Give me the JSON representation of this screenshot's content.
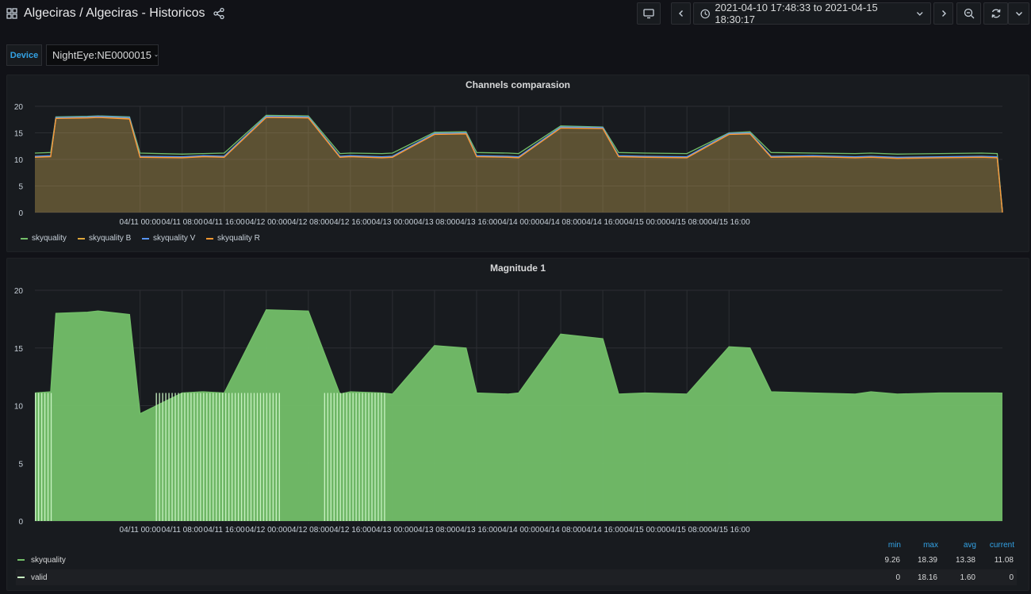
{
  "header": {
    "title": "Algeciras / Algeciras - Historicos",
    "time_range": "2021-04-10 17:48:33 to 2021-04-15 18:30:17",
    "icons": [
      "grid-icon",
      "share-icon",
      "tv-icon",
      "chevron-left-icon",
      "clock-icon",
      "chevron-down-icon",
      "chevron-right-icon",
      "zoom-out-icon",
      "refresh-icon",
      "chevron-down-icon"
    ]
  },
  "variables": {
    "device_label": "Device",
    "device_value": "NightEye:NE0000015"
  },
  "colors": {
    "skyquality": "#73bf69",
    "skyquality_b": "#e0a83a",
    "skyquality_v": "#5794f2",
    "skyquality_r": "#ff9830",
    "valid": "#c8f2c2",
    "accent": "#33a2e5"
  },
  "panel1": {
    "title": "Channels comparasion",
    "legend": [
      "skyquality",
      "skyquality B",
      "skyquality V",
      "skyquality R"
    ]
  },
  "panel2": {
    "title": "Magnitude 1",
    "stats_headers": [
      "min",
      "max",
      "avg",
      "current"
    ],
    "rows": [
      {
        "name": "skyquality",
        "min": "9.26",
        "max": "18.39",
        "avg": "13.38",
        "current": "11.08"
      },
      {
        "name": "valid",
        "min": "0",
        "max": "18.16",
        "avg": "1.60",
        "current": "0"
      }
    ]
  },
  "chart_data": [
    {
      "type": "area",
      "title": "Channels comparasion",
      "ylim": [
        0,
        20
      ],
      "y_ticks": [
        "0",
        "5",
        "10",
        "15",
        "20"
      ],
      "x_ticks": [
        "04/11 00:00",
        "04/11 08:00",
        "04/11 16:00",
        "04/12 00:00",
        "04/12 08:00",
        "04/12 16:00",
        "04/13 00:00",
        "04/13 08:00",
        "04/13 16:00",
        "04/14 00:00",
        "04/14 08:00",
        "04/14 16:00",
        "04/15 00:00",
        "04/15 08:00",
        "04/15 16:00"
      ],
      "x_hours": [
        -20,
        -17,
        -16,
        -10,
        -8,
        -2,
        0,
        8,
        12,
        16,
        24,
        32,
        38,
        40,
        46,
        48,
        56,
        62,
        64,
        70,
        72,
        80,
        88,
        91,
        96,
        104,
        112,
        116,
        120,
        128,
        136,
        139,
        144,
        152,
        160,
        163,
        164
      ],
      "series": [
        {
          "name": "skyquality",
          "values": [
            11.2,
            11.3,
            18.0,
            18.1,
            18.2,
            18.0,
            11.2,
            11.0,
            11.1,
            11.2,
            18.3,
            18.2,
            11.1,
            11.2,
            11.1,
            11.2,
            15.1,
            15.2,
            11.3,
            11.2,
            11.1,
            16.3,
            16.1,
            11.3,
            11.2,
            11.1,
            15.0,
            15.2,
            11.3,
            11.2,
            11.1,
            11.2,
            11.0,
            11.1,
            11.2,
            11.1,
            0.3
          ]
        },
        {
          "name": "skyquality B",
          "values": [
            10.5,
            10.6,
            17.8,
            17.9,
            18.0,
            17.7,
            10.5,
            10.4,
            10.6,
            10.5,
            18.0,
            17.9,
            10.5,
            10.6,
            10.4,
            10.5,
            14.8,
            14.9,
            10.6,
            10.5,
            10.4,
            16.0,
            15.9,
            10.6,
            10.5,
            10.4,
            14.8,
            14.9,
            10.5,
            10.6,
            10.4,
            10.5,
            10.3,
            10.4,
            10.5,
            10.4,
            0.1
          ]
        },
        {
          "name": "skyquality V",
          "values": [
            10.6,
            10.7,
            17.9,
            18.0,
            18.1,
            17.9,
            10.6,
            10.5,
            10.7,
            10.6,
            18.1,
            18.0,
            10.6,
            10.7,
            10.5,
            10.6,
            14.9,
            15.0,
            10.7,
            10.6,
            10.5,
            16.1,
            16.0,
            10.7,
            10.6,
            10.5,
            14.9,
            15.0,
            10.6,
            10.7,
            10.5,
            10.6,
            10.4,
            10.5,
            10.6,
            10.5,
            0.1
          ]
        },
        {
          "name": "skyquality R",
          "values": [
            10.4,
            10.5,
            17.7,
            17.8,
            17.9,
            17.6,
            10.4,
            10.3,
            10.5,
            10.4,
            17.9,
            17.8,
            10.4,
            10.5,
            10.3,
            10.4,
            14.7,
            14.8,
            10.5,
            10.4,
            10.3,
            15.9,
            15.8,
            10.5,
            10.4,
            10.3,
            14.7,
            14.8,
            10.4,
            10.5,
            10.3,
            10.4,
            10.2,
            10.3,
            10.4,
            10.3,
            0.0
          ]
        }
      ]
    },
    {
      "type": "area",
      "title": "Magnitude 1",
      "ylim": [
        0,
        20
      ],
      "y_ticks": [
        "0",
        "5",
        "10",
        "15",
        "20"
      ],
      "x_ticks": [
        "04/11 00:00",
        "04/11 08:00",
        "04/11 16:00",
        "04/12 00:00",
        "04/12 08:00",
        "04/12 16:00",
        "04/13 00:00",
        "04/13 08:00",
        "04/13 16:00",
        "04/14 00:00",
        "04/14 08:00",
        "04/14 16:00",
        "04/15 00:00",
        "04/15 08:00",
        "04/15 16:00"
      ],
      "x_hours": [
        -20,
        -17,
        -16,
        -10,
        -8,
        -2,
        0,
        8,
        12,
        16,
        24,
        32,
        38,
        40,
        46,
        48,
        56,
        62,
        64,
        70,
        72,
        80,
        88,
        91,
        96,
        104,
        112,
        116,
        120,
        128,
        136,
        139,
        144,
        152,
        160,
        163,
        164
      ],
      "series": [
        {
          "name": "skyquality",
          "values": [
            11.1,
            11.2,
            18.0,
            18.1,
            18.2,
            17.9,
            9.3,
            11.1,
            11.2,
            11.1,
            18.3,
            18.2,
            11.0,
            11.2,
            11.1,
            11.0,
            15.2,
            15.0,
            11.1,
            11.0,
            11.1,
            16.2,
            15.8,
            11.0,
            11.1,
            11.0,
            15.1,
            15.0,
            11.2,
            11.1,
            11.0,
            11.2,
            11.0,
            11.1,
            11.1,
            11.1,
            11.08
          ]
        },
        {
          "name": "valid",
          "segments": [
            [
              -20,
              -16.5
            ],
            [
              3,
              27
            ],
            [
              35,
              47
            ]
          ],
          "value": 11.1
        }
      ]
    }
  ]
}
